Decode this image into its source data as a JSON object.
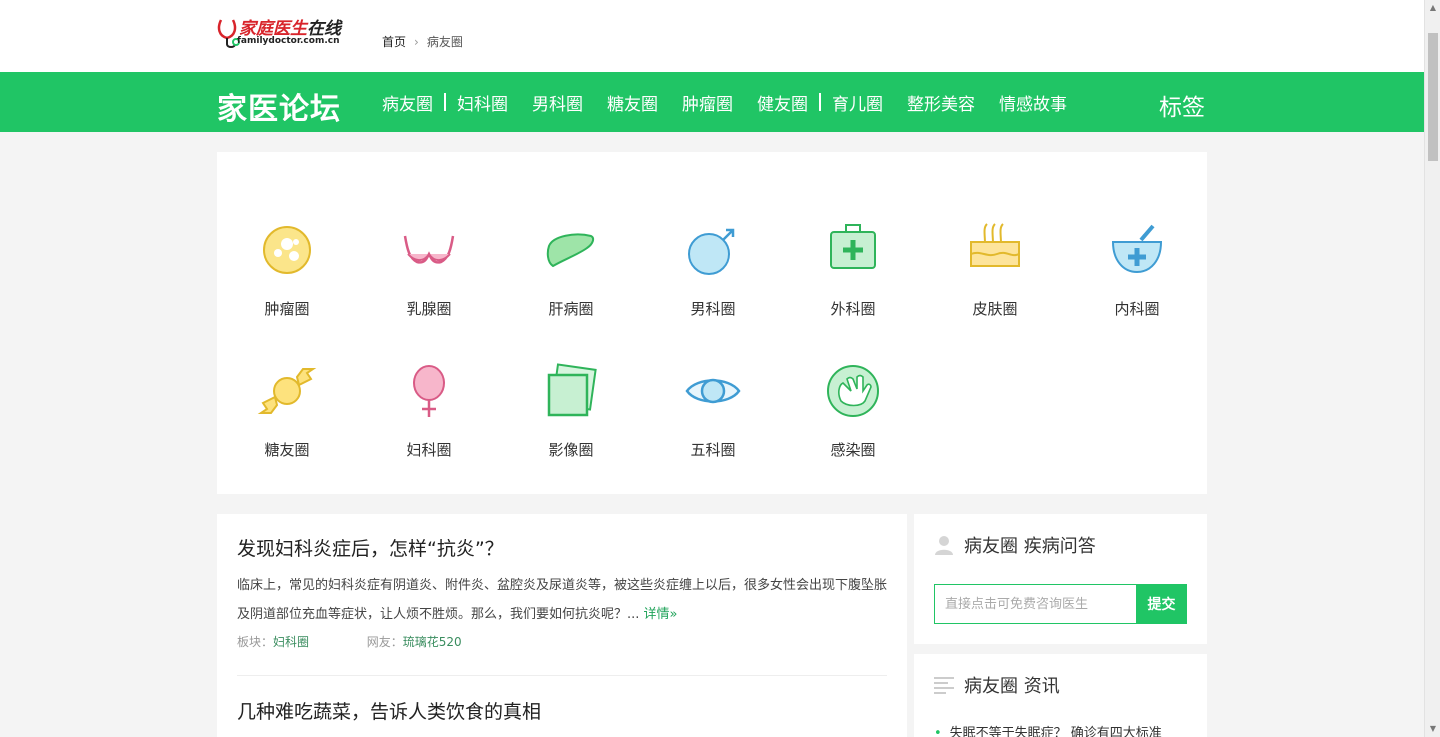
{
  "header": {
    "logo_cn_red": "家庭医生",
    "logo_cn_black": "在线",
    "logo_en": "familydoctor.com.cn",
    "breadcrumb": {
      "home": "首页",
      "separator": "›",
      "current": "病友圈"
    }
  },
  "nav": {
    "brand": "家医论坛",
    "items": [
      "病友圈",
      "妇科圈",
      "男科圈",
      "糖友圈",
      "肿瘤圈",
      "健友圈",
      "育儿圈",
      "整形美容",
      "情感故事"
    ],
    "tags": "标签",
    "color": "#20c565"
  },
  "categories": [
    {
      "label": "肿瘤圈",
      "icon": "tumor-cell-icon"
    },
    {
      "label": "乳腺圈",
      "icon": "bra-icon"
    },
    {
      "label": "肝病圈",
      "icon": "liver-icon"
    },
    {
      "label": "男科圈",
      "icon": "male-symbol-icon"
    },
    {
      "label": "外科圈",
      "icon": "first-aid-kit-icon"
    },
    {
      "label": "皮肤圈",
      "icon": "skin-hair-icon"
    },
    {
      "label": "内科圈",
      "icon": "mortar-pestle-icon"
    },
    {
      "label": "糖友圈",
      "icon": "candy-icon"
    },
    {
      "label": "妇科圈",
      "icon": "female-balloon-icon"
    },
    {
      "label": "影像圈",
      "icon": "xray-film-icon"
    },
    {
      "label": "五科圈",
      "icon": "eye-icon"
    },
    {
      "label": "感染圈",
      "icon": "hand-icon"
    }
  ],
  "articles": [
    {
      "title": "发现妇科炎症后，怎样“抗炎”？",
      "body": "临床上，常见的妇科炎症有阴道炎、附件炎、盆腔炎及尿道炎等，被这些炎症缠上以后，很多女性会出现下腹坠胀及阴道部位充血等症状，让人烦不胜烦。那么，我们要如何抗炎呢？...",
      "more": "详情»",
      "board_label": "板块：",
      "board": "妇科圈",
      "user_label": "网友：",
      "user": "琉璃花520"
    },
    {
      "title": "几种难吃蔬菜，告诉人类饮食的真相"
    }
  ],
  "sidebar": {
    "qa": {
      "title": "病友圈 疾病问答",
      "placeholder": "直接点击可免费咨询医生",
      "submit": "提交"
    },
    "news": {
      "title": "病友圈 资讯",
      "items": [
        "失眠不等于失眠症？ 确诊有四大标准"
      ]
    }
  }
}
